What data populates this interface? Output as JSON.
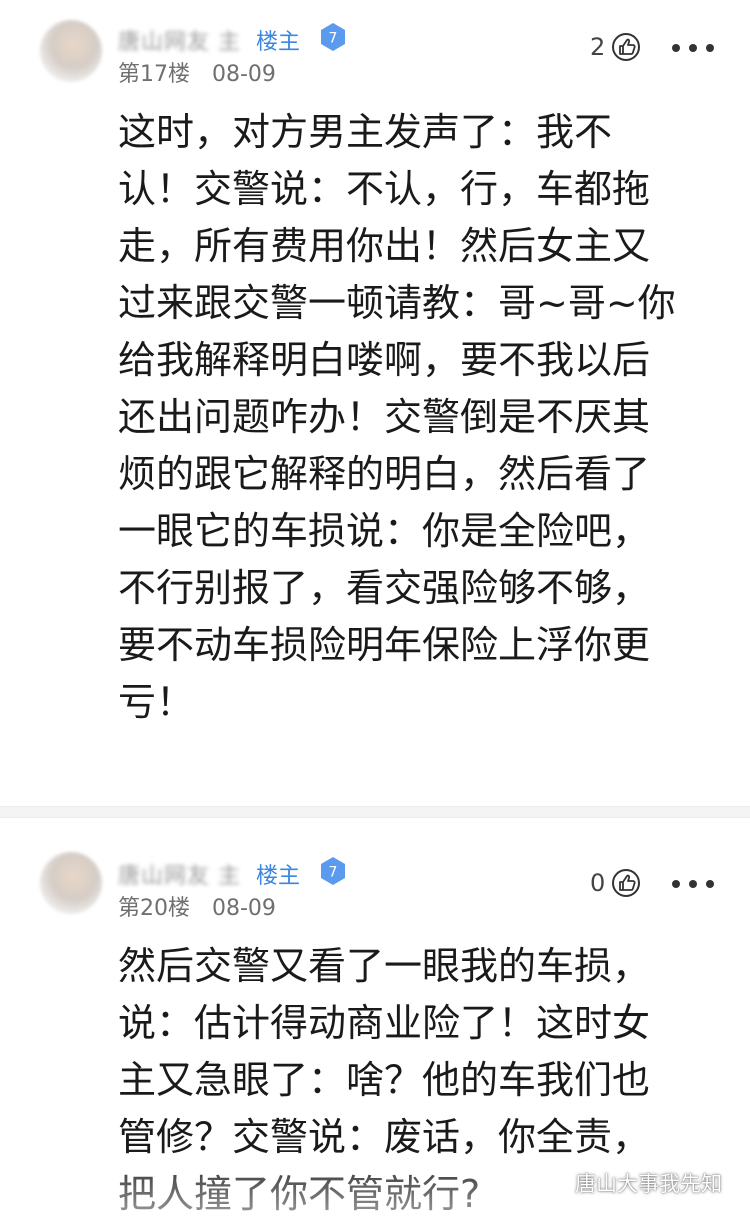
{
  "posts": [
    {
      "username": "唐山网友 主",
      "owner_tag": "楼主",
      "level": "7",
      "floor": "第17楼",
      "date": "08-09",
      "likes": "2",
      "content_lines": [
        "这时，对方男主发声了：我不",
        "认！交警说：不认，行，车都拖",
        "走，所有费用你出！然后女主又",
        "过来跟交警一顿请教：哥~哥~你",
        "给我解释明白喽啊，要不我以后",
        "还出问题咋办！交警倒是不厌其",
        "烦的跟它解释的明白，然后看了",
        "一眼它的车损说：你是全险吧，",
        "不行别报了，看交强险够不够，",
        "要不动车损险明年保险上浮你更",
        "亏！"
      ]
    },
    {
      "username": "唐山网友 主",
      "owner_tag": "楼主",
      "level": "7",
      "floor": "第20楼",
      "date": "08-09",
      "likes": "0",
      "content_lines": [
        "然后交警又看了一眼我的车损，",
        "说：估计得动商业险了！这时女",
        "主又急眼了：啥？他的车我们也",
        "管修？交警说：废话，你全责，",
        "把人撞了你不管就行?"
      ]
    }
  ],
  "watermark": {
    "text": "唐山大事我先知",
    "icon": "wechat-icon"
  },
  "colors": {
    "owner_tag": "#3a86e0",
    "badge": "#5b9bef",
    "text": "#1a1a1a",
    "meta": "#6f6f6f"
  }
}
